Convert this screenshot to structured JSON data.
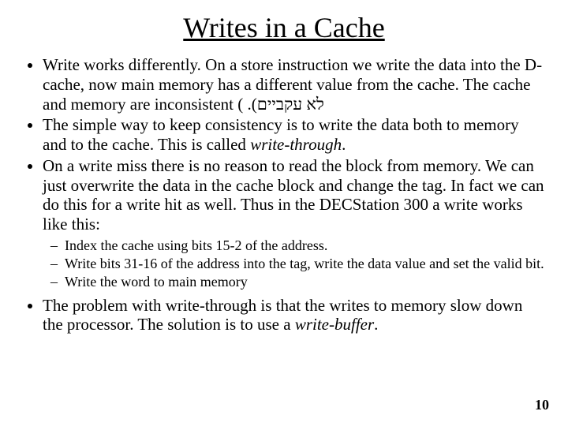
{
  "title": "Writes in a Cache",
  "bullets": {
    "b1_a": "Write works differently. On a store instruction we write the data into the D-cache, now main memory has a different value from the cache. The cache and memory are inconsistent ( .(",
    "b1_b": "לא עקביים",
    "b2_a": "The simple way to keep consistency is to write the data both to memory and to the cache. This is called ",
    "b2_b": "write-through",
    "b2_c": ".",
    "b3": "On a write miss there is no reason to read the block from memory. We can just overwrite the data in the cache block and change the tag. In fact we can do this for a write hit as well. Thus in the DECStation 300 a write works like this:",
    "s1": "Index the cache using bits 15-2 of the address.",
    "s2": "Write bits 31-16 of the address into the tag, write the data value and set the valid bit.",
    "s3": "Write the word to main memory",
    "b4_a": "The problem with write-through is that the writes to memory slow down the processor. The solution is to use a ",
    "b4_b": "write-buffer",
    "b4_c": "."
  },
  "page_number": "10"
}
